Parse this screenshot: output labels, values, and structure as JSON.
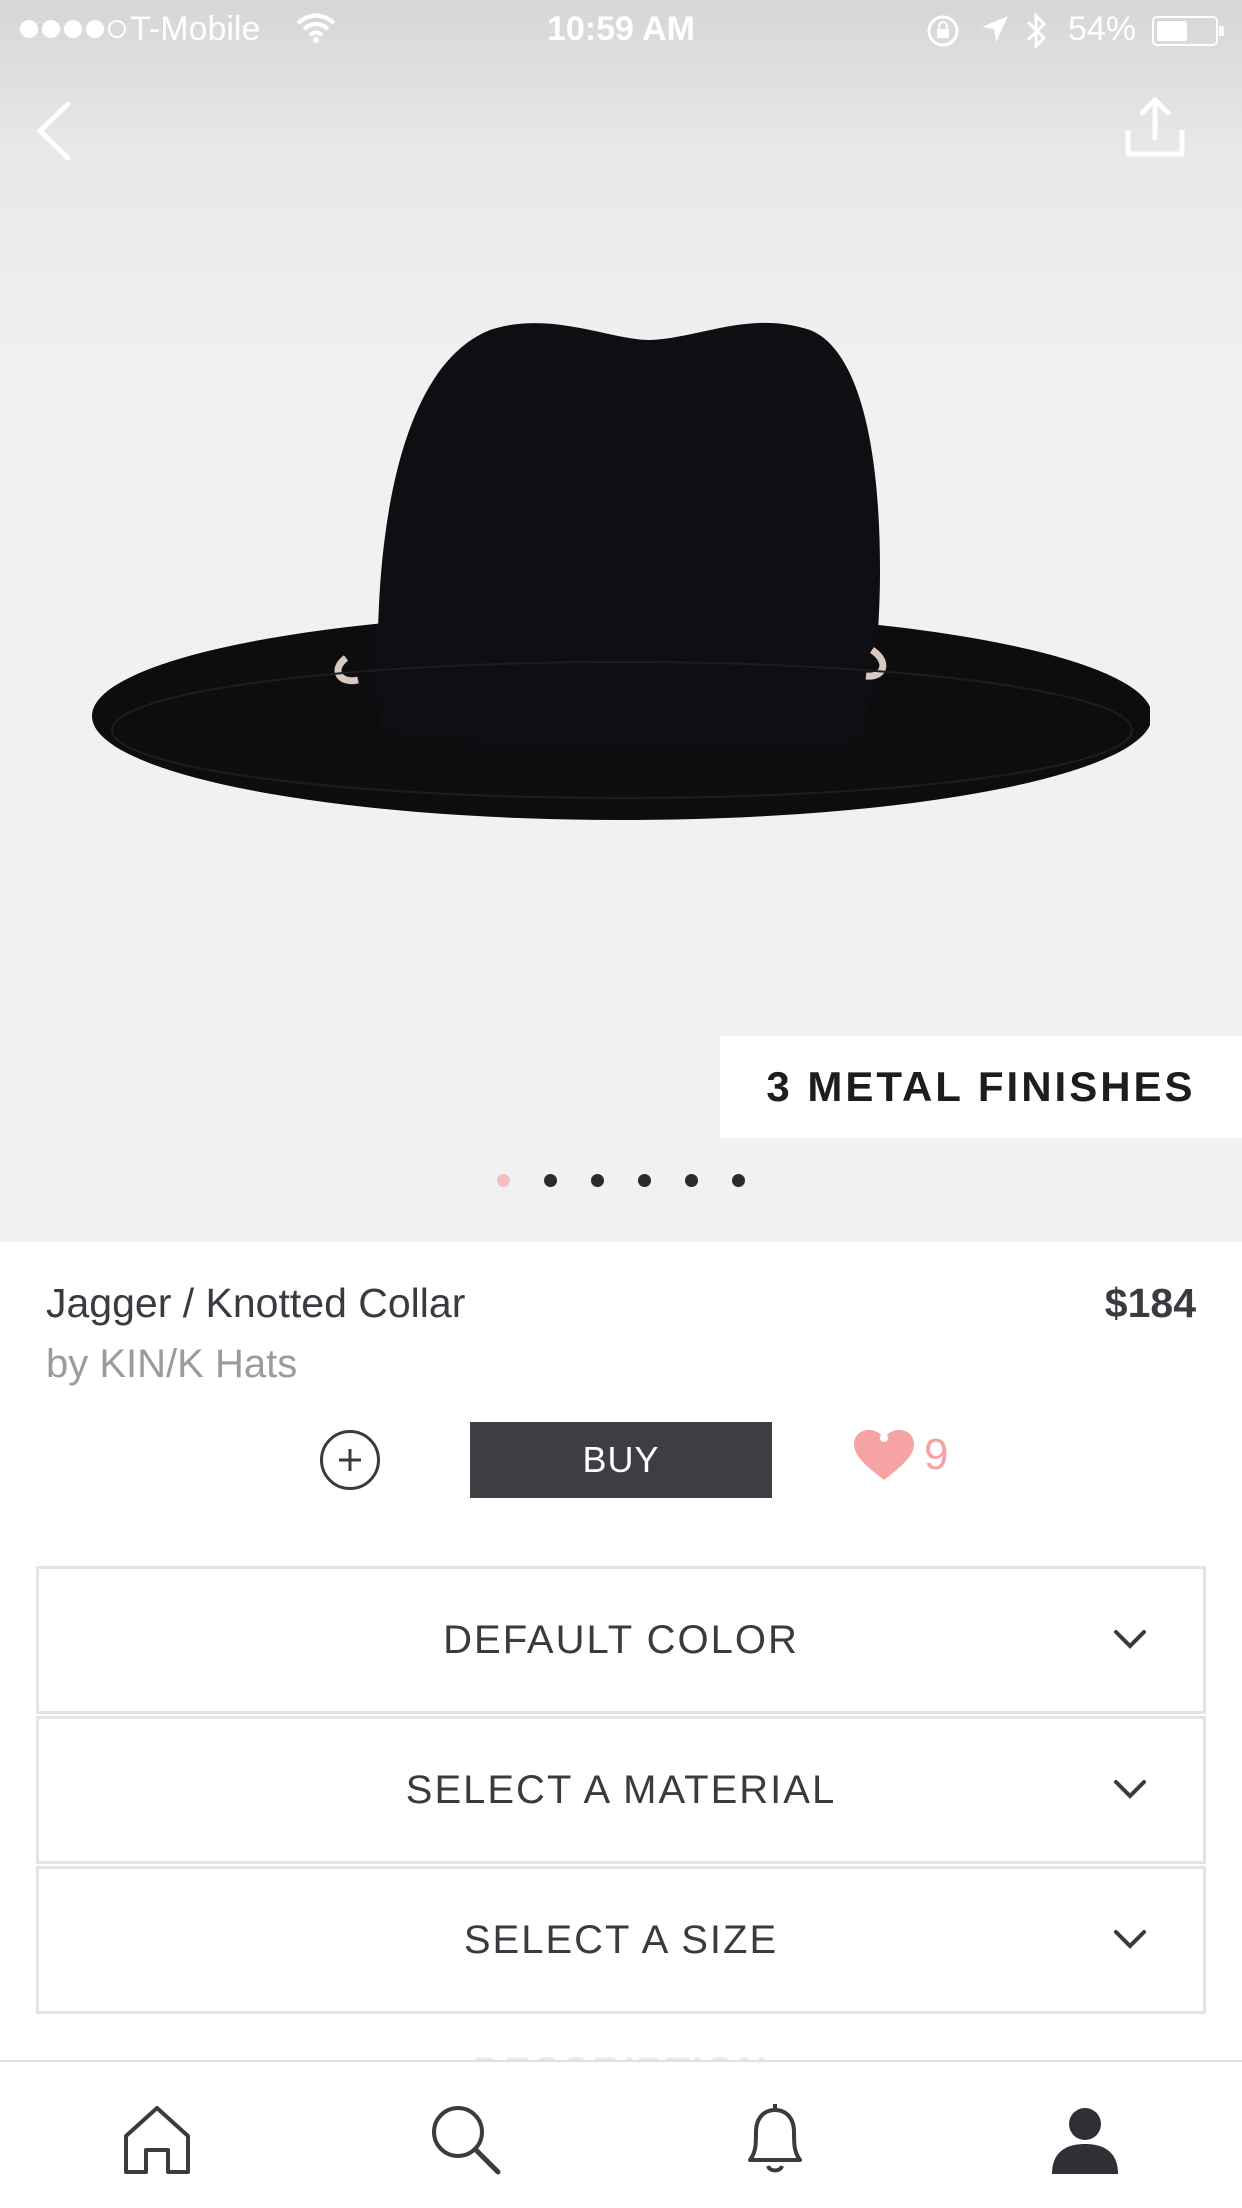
{
  "status_bar": {
    "carrier": "T-Mobile",
    "time": "10:59 AM",
    "battery": "54%",
    "battery_level": 0.54
  },
  "header": {
    "back_icon": "chevron-left-icon",
    "share_icon": "share-icon"
  },
  "gallery": {
    "badge": "3 METAL FINISHES",
    "page_count": 6,
    "active_page": 1
  },
  "product": {
    "name": "Jagger / Knotted Collar",
    "brand": "by KIN/K Hats",
    "price": "$184"
  },
  "actions": {
    "buy_label": "BUY",
    "like_count": "9",
    "like_color": "#f6a3a3"
  },
  "options": [
    {
      "label": "DEFAULT COLOR"
    },
    {
      "label": "SELECT A MATERIAL"
    },
    {
      "label": "SELECT A SIZE"
    }
  ],
  "description_peek": "DESCRIPTION",
  "tab_bar": {
    "tabs": [
      "home-icon",
      "search-icon",
      "bell-icon",
      "profile-icon"
    ],
    "active": "profile-icon"
  },
  "colors": {
    "accent_pink": "#f6bfbf",
    "button_dark": "#3d3e44"
  }
}
